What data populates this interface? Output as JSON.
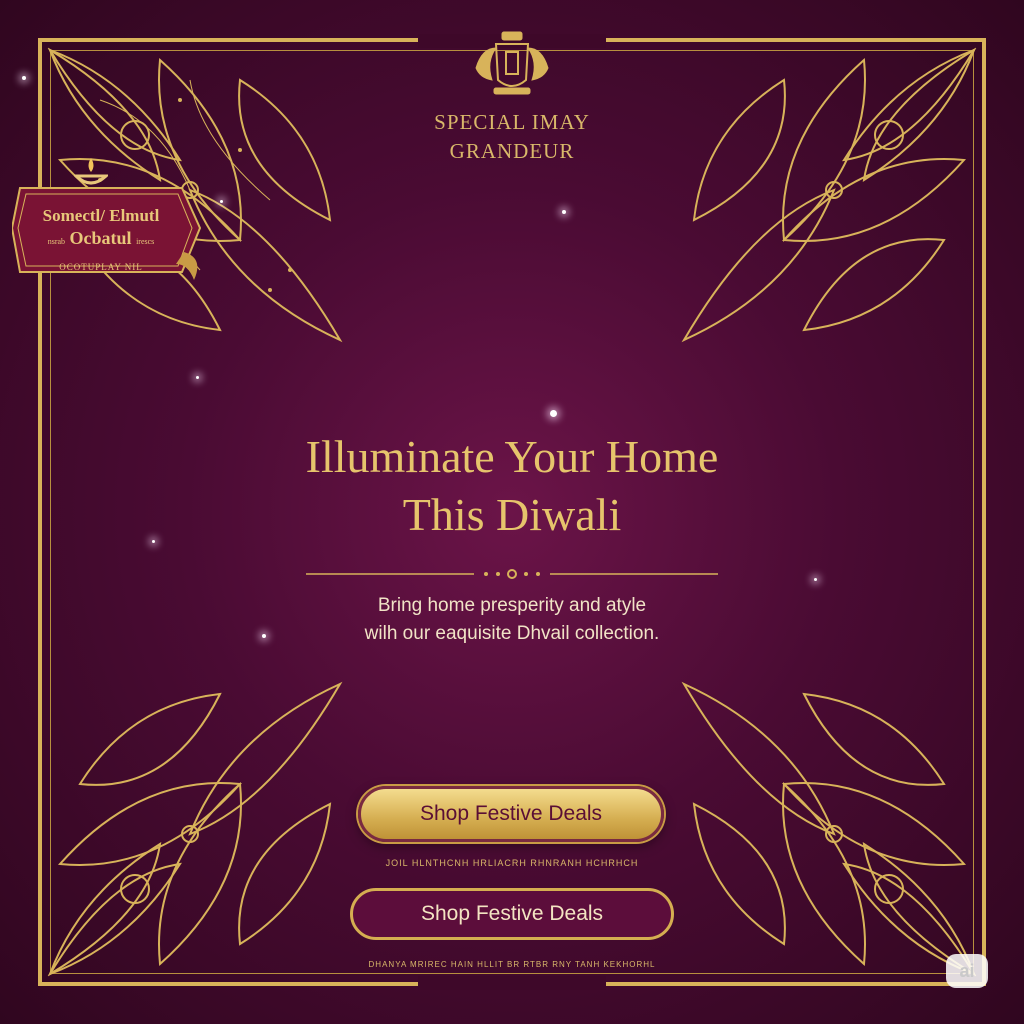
{
  "brand": {
    "line1": "SPECIAL IMAY",
    "line2": "GRANDEUR"
  },
  "badge": {
    "line1": "Somectl/ Elmutl",
    "line2": "Ocbatul",
    "line2_left": "nsrab",
    "line2_right": "irescs",
    "line3": "OCOTUPLAY NIL"
  },
  "hero": {
    "headline_line1": "Illuminate Your Home",
    "headline_line2": "This Diwali",
    "subtitle_line1": "Bring home presperity and atyle",
    "subtitle_line2": "wilh our eaquisite Dhvail collection."
  },
  "cta": {
    "primary_label": "Shop Festive Deals",
    "fineprint": "JOIL HLNTHCNH  HRLIACRH RHNRANH HCHRHCH",
    "secondary_label": "Shop Festive Deals",
    "terms": "DHANYA MRIREC HAIN HLLIT BR RTBR RNY TANH KEKHORHL"
  },
  "corner_badge": "ai",
  "colors": {
    "background": "#4a0b33",
    "gold": "#d8b35a",
    "cream": "#f1e3c6",
    "button_text": "#5a0e35"
  }
}
